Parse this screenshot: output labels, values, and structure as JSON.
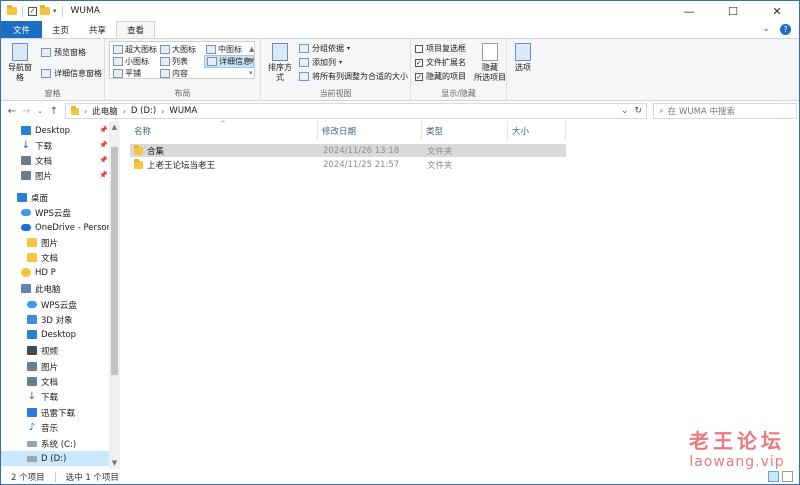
{
  "window": {
    "title": "WUMA",
    "controls": {
      "minimize": "—",
      "maximize": "☐",
      "close": "✕"
    }
  },
  "ribbon_tabs": [
    "文件",
    "主页",
    "共享",
    "查看"
  ],
  "ribbon": {
    "panes": {
      "label": "窗格",
      "nav_pane": "导航窗格",
      "preview_pane": "预览窗格",
      "details_pane": "详细信息窗格"
    },
    "layout": {
      "label": "布局",
      "items": [
        "超大图标",
        "大图标",
        "中图标",
        "小图标",
        "列表",
        "详细信息",
        "平铺",
        "内容"
      ],
      "selected": "详细信息"
    },
    "current_view": {
      "label": "当前视图",
      "sort_by": "排序方式",
      "group_by": "分组依据",
      "add_columns": "添加列",
      "fit_columns": "将所有列调整为合适的大小"
    },
    "show_hide": {
      "label": "显示/隐藏",
      "item_checkboxes": {
        "text": "项目复选框",
        "checked": false
      },
      "file_extensions": {
        "text": "文件扩展名",
        "checked": true
      },
      "hidden_items": {
        "text": "隐藏的项目",
        "checked": true
      },
      "hide_selected": "隐藏\n所选项目"
    },
    "options": "选项"
  },
  "address": {
    "path": [
      "此电脑",
      "D (D:)",
      "WUMA"
    ],
    "search_placeholder": "在 WUMA 中搜索"
  },
  "nav_pane": {
    "items": [
      {
        "label": "Desktop",
        "icon": "desktop-icon",
        "pinned": true
      },
      {
        "label": "下载",
        "icon": "download-icon",
        "pinned": true
      },
      {
        "label": "文档",
        "icon": "document-icon",
        "pinned": true
      },
      {
        "label": "图片",
        "icon": "picture-icon",
        "pinned": true
      },
      {
        "label": "桌面",
        "icon": "desktop-icon"
      },
      {
        "label": "WPS云盘",
        "icon": "cloud-icon"
      },
      {
        "label": "OneDrive - Personal",
        "icon": "onedrive-icon"
      },
      {
        "label": "图片",
        "icon": "folder-icon"
      },
      {
        "label": "文档",
        "icon": "folder-icon"
      },
      {
        "label": "HD P",
        "icon": "user-icon"
      },
      {
        "label": "此电脑",
        "icon": "computer-icon"
      },
      {
        "label": "WPS云盘",
        "icon": "cloud-icon"
      },
      {
        "label": "3D 对象",
        "icon": "3d-objects-icon"
      },
      {
        "label": "Desktop",
        "icon": "desktop-icon"
      },
      {
        "label": "视频",
        "icon": "video-icon"
      },
      {
        "label": "图片",
        "icon": "picture-icon"
      },
      {
        "label": "文档",
        "icon": "document-icon"
      },
      {
        "label": "下载",
        "icon": "download-icon"
      },
      {
        "label": "迅雷下载",
        "icon": "xunlei-icon"
      },
      {
        "label": "音乐",
        "icon": "music-icon"
      },
      {
        "label": "系统 (C:)",
        "icon": "drive-icon"
      },
      {
        "label": "D (D:)",
        "icon": "drive-icon",
        "selected": true
      }
    ]
  },
  "file_list": {
    "columns": [
      "名称",
      "修改日期",
      "类型",
      "大小"
    ],
    "rows": [
      {
        "name": "合集",
        "modified": "2024/11/26 13:18",
        "type": "文件夹",
        "size": "",
        "selected": true
      },
      {
        "name": "上老王论坛当老王",
        "modified": "2024/11/25 21:57",
        "type": "文件夹",
        "size": ""
      }
    ]
  },
  "status": {
    "item_count": "2 个项目",
    "selected": "选中 1 个项目"
  },
  "watermark": {
    "line1": "老王论坛",
    "line2": "laowang.vip"
  },
  "colors": {
    "file_tab": "#1b6ec2",
    "selection": "#cce8ff",
    "row_selected": "#d9d9d9",
    "folder": "#f5c542",
    "watermark": "#e8606a"
  }
}
